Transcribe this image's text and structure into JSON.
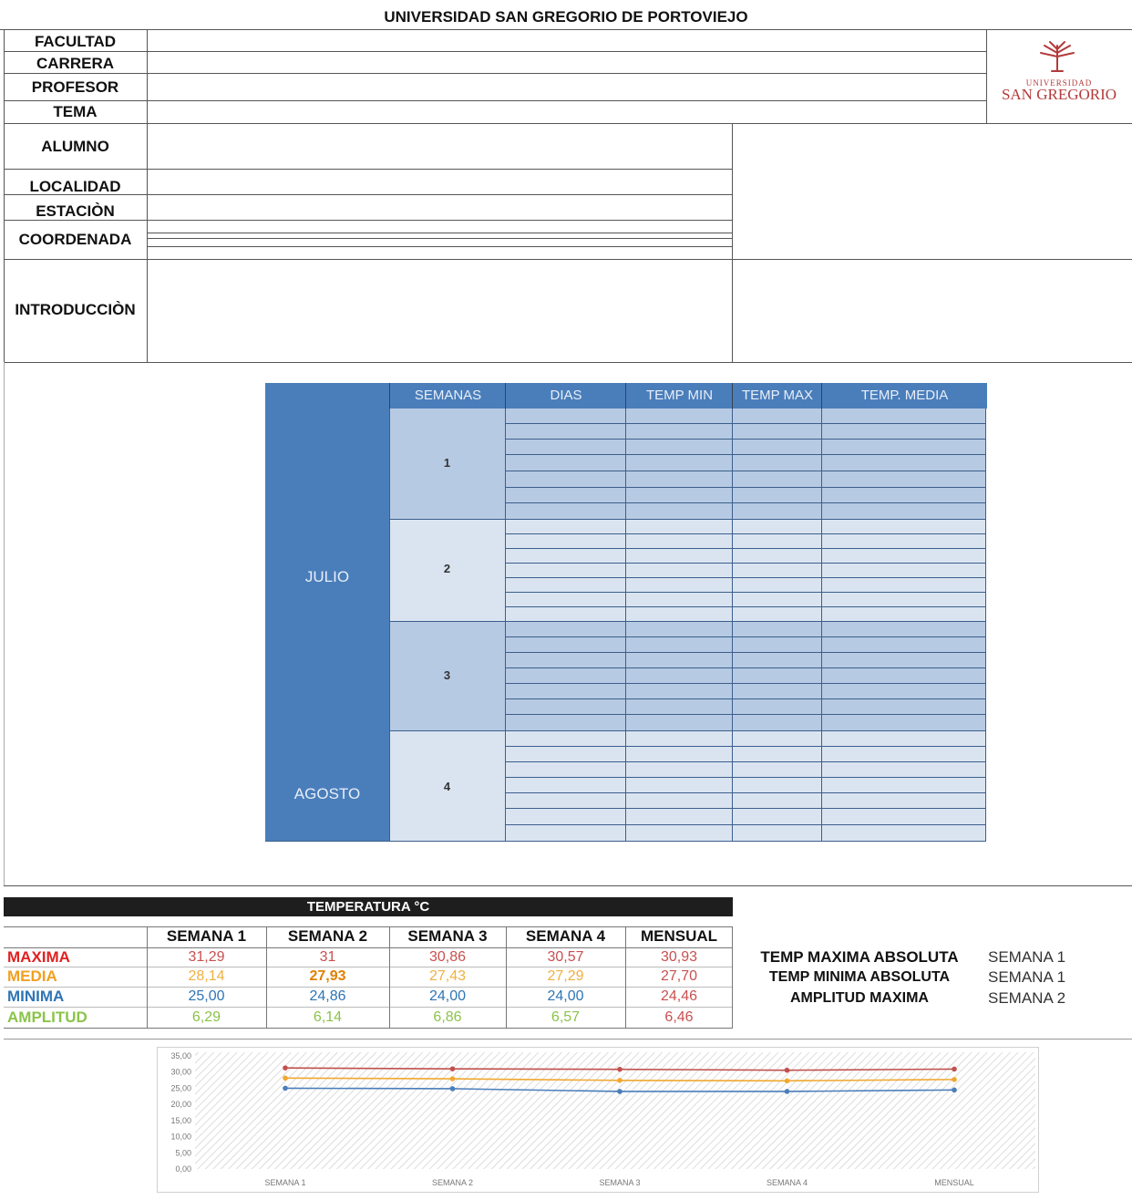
{
  "header": {
    "title": "UNIVERSIDAD SAN GREGORIO DE PORTOVIEJO",
    "logo_line1": "UNIVERSIDAD",
    "logo_line2": "SAN GREGORIO"
  },
  "form": {
    "facultad": "FACULTAD",
    "carrera": "CARRERA",
    "profesor": "PROFESOR",
    "tema": "TEMA",
    "alumno": "ALUMNO",
    "localidad": "LOCALIDAD",
    "estacion": "ESTACIÒN",
    "coordenada": "COORDENADA",
    "introduccion": "INTRODUCCIÒN"
  },
  "weekly_table": {
    "headers": [
      "SEMANAS",
      "DIAS",
      "TEMP MIN",
      "TEMP MAX",
      "TEMP. MEDIA"
    ],
    "months": [
      "JULIO",
      "AGOSTO"
    ],
    "weeks": [
      "1",
      "2",
      "3",
      "4"
    ]
  },
  "temp_table": {
    "title": "TEMPERATURA °C",
    "columns": [
      "SEMANA 1",
      "SEMANA 2",
      "SEMANA 3",
      "SEMANA 4",
      "MENSUAL"
    ],
    "rows": [
      {
        "label": "MAXIMA",
        "color": "#e02020",
        "value_color": "#c85050",
        "values": [
          "31,29",
          "31",
          "30,86",
          "30,57",
          "30,93"
        ]
      },
      {
        "label": "MEDIA",
        "color": "#f0a020",
        "value_color": "#f0b040",
        "values": [
          "28,14",
          "27,93",
          "27,43",
          "27,29",
          "27,70"
        ]
      },
      {
        "label": "MINIMA",
        "color": "#2e75b6",
        "value_color": "#2e75b6",
        "values": [
          "25,00",
          "24,86",
          "24,00",
          "24,00",
          "24,46"
        ]
      },
      {
        "label": "AMPLITUD",
        "color": "#8bc34a",
        "value_color": "#8bc34a",
        "values": [
          "6,29",
          "6,14",
          "6,86",
          "6,57",
          "6,46"
        ]
      }
    ],
    "special_value_colors": {
      "MEDIA_2": "#e08000",
      "MINIMA_5": "#c85050",
      "AMPLITUD_5": "#c85050"
    }
  },
  "summary": [
    {
      "label": "TEMP MAXIMA ABSOLUTA",
      "value": "SEMANA 1"
    },
    {
      "label": "TEMP MINIMA ABSOLUTA",
      "value": "SEMANA 1"
    },
    {
      "label": "AMPLITUD MAXIMA",
      "value": "SEMANA 2"
    }
  ],
  "chart_data": {
    "type": "line",
    "categories": [
      "SEMANA 1",
      "SEMANA 2",
      "SEMANA 3",
      "SEMANA 4",
      "MENSUAL"
    ],
    "yticks": [
      "0,00",
      "5,00",
      "10,00",
      "15,00",
      "20,00",
      "25,00",
      "30,00",
      "35,00"
    ],
    "ylim": [
      0,
      35
    ],
    "series": [
      {
        "color": "#c0504d",
        "values": [
          31.29,
          31,
          30.86,
          30.57,
          30.93
        ]
      },
      {
        "color": "#f0a830",
        "values": [
          28.14,
          27.93,
          27.43,
          27.29,
          27.7
        ]
      },
      {
        "color": "#4a7ebb",
        "values": [
          25.0,
          24.86,
          24.0,
          24.0,
          24.46
        ]
      }
    ]
  }
}
